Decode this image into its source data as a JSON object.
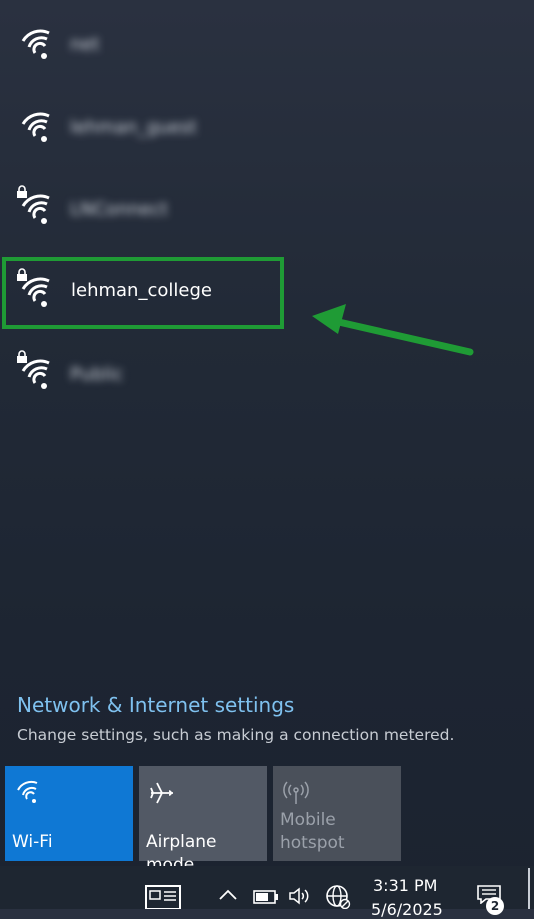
{
  "networks": [
    {
      "name": "net",
      "secured": false,
      "blurred": true
    },
    {
      "name": "lehman_guest",
      "secured": false,
      "blurred": true
    },
    {
      "name": "LNConnect",
      "secured": true,
      "blurred": true
    },
    {
      "name": "lehman_college",
      "secured": true,
      "blurred": false,
      "highlighted": true
    },
    {
      "name": "Public",
      "secured": true,
      "blurred": true
    }
  ],
  "settings": {
    "link_label": "Network & Internet settings",
    "description": "Change settings, such as making a connection metered."
  },
  "quick_actions": [
    {
      "label": "Wi-Fi",
      "icon": "wifi-icon",
      "state": "on"
    },
    {
      "label": "Airplane mode",
      "icon": "airplane-icon",
      "state": "off"
    },
    {
      "label_line1": "Mobile",
      "label_line2": "hotspot",
      "icon": "hotspot-icon",
      "state": "disabled"
    }
  ],
  "taskbar": {
    "time": "3:31 PM",
    "date": "5/6/2025",
    "notification_count": "2",
    "icons": [
      "news-icon",
      "chevron-up-icon",
      "battery-icon",
      "volume-icon",
      "globe-icon",
      "action-center-icon"
    ]
  },
  "colors": {
    "highlight": "#1f9b35",
    "accent": "#0f78d4",
    "link": "#7fc1ef"
  }
}
